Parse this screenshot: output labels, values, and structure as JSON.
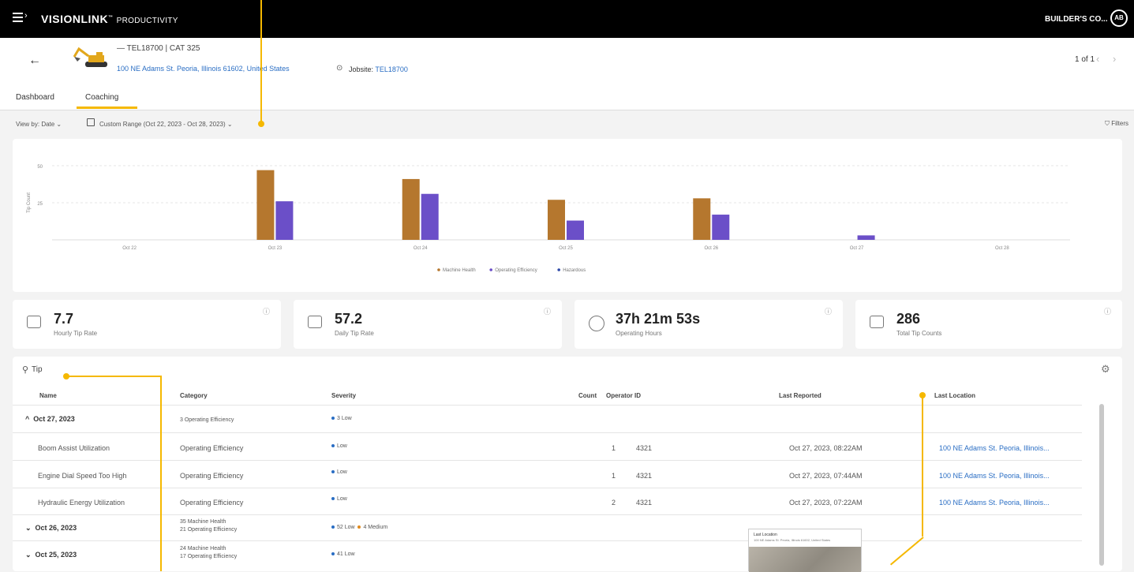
{
  "topbar": {
    "brand": "VISIONLINK",
    "brand_suffix": "PRODUCTIVITY",
    "company": "BUILDER'S CO...",
    "avatar": "AB"
  },
  "asset": {
    "name": "— TEL18700",
    "separator": "|",
    "model": "CAT 325",
    "address": "100 NE Adams St. Peoria, Illinois 61602, United States",
    "jobsite_label": "Jobsite:",
    "jobsite_value": "TEL18700"
  },
  "pager": {
    "text": "1 of 1",
    "prev": "‹",
    "next": "›"
  },
  "tabs": [
    {
      "label": "Dashboard"
    },
    {
      "label": "Coaching"
    }
  ],
  "toolbar": {
    "view_by": "View by: Date ⌄",
    "range": "Custom Range (Oct 22, 2023 - Oct 28, 2023) ⌄",
    "filters": "Filters"
  },
  "chart_data": {
    "type": "bar",
    "categories": [
      "Oct 22",
      "Oct 23",
      "Oct 24",
      "Oct 25",
      "Oct 26",
      "Oct 27",
      "Oct 28"
    ],
    "series": [
      {
        "name": "Machine Health",
        "values": [
          0,
          47,
          41,
          27,
          28,
          0,
          0
        ],
        "color": "#b5772e"
      },
      {
        "name": "Operating Efficiency",
        "values": [
          0,
          26,
          31,
          13,
          17,
          3,
          0
        ],
        "color": "#6b4fc8"
      },
      {
        "name": "Hazardous",
        "values": [
          0,
          0,
          0,
          0,
          0,
          0,
          0
        ],
        "color": "#2f4aa8"
      }
    ],
    "ylabel": "Tip Count",
    "yticks": [
      "50",
      "25"
    ],
    "ylim": [
      0,
      50
    ],
    "legend": "bottom"
  },
  "stats": [
    {
      "value": "7.7",
      "label": "Hourly Tip Rate"
    },
    {
      "value": "57.2",
      "label": "Daily Tip Rate"
    },
    {
      "value": "37h 21m 53s",
      "label": "Operating Hours"
    },
    {
      "value": "286",
      "label": "Total Tip Counts"
    }
  ],
  "table": {
    "search_value": "Tip",
    "columns": [
      "Name",
      "Category",
      "Severity",
      "Count",
      "Operator ID",
      "Last Reported",
      "Last Location"
    ],
    "groups": [
      {
        "date": "Oct 27, 2023",
        "category": "3 Operating Efficiency",
        "severity": "3 Low"
      },
      {
        "date": "Oct 26, 2023",
        "category_1": "35 Machine Health",
        "category_2": "21 Operating Efficiency",
        "severity_low": "52 Low",
        "severity_medium": "4 Medium"
      },
      {
        "date": "Oct 25, 2023",
        "category_1": "24 Machine Health",
        "category_2": "17 Operating Efficiency",
        "severity": "41 Low"
      }
    ],
    "rows": [
      {
        "name": "Boom Assist Utilization",
        "category": "Operating Efficiency",
        "severity": "Low",
        "count": "1",
        "operator": "4321",
        "reported": "Oct 27, 2023, 08:22AM",
        "location": "100 NE Adams St. Peoria, Illinois..."
      },
      {
        "name": "Engine Dial Speed Too High",
        "category": "Operating Efficiency",
        "severity": "Low",
        "count": "1",
        "operator": "4321",
        "reported": "Oct 27, 2023, 07:44AM",
        "location": "100 NE Adams St. Peoria, Illinois..."
      },
      {
        "name": "Hydraulic Energy Utilization",
        "category": "Operating Efficiency",
        "severity": "Low",
        "count": "2",
        "operator": "4321",
        "reported": "Oct 27, 2023, 07:22AM",
        "location": "100 NE Adams St. Peoria, Illinois..."
      }
    ],
    "map_popup": {
      "title": "Last Location",
      "subtitle": "100 NE Adams St. Peoria, Illinois 61602, United States"
    }
  },
  "colors": {
    "accent": "#f5b800",
    "link": "#2a6ec4",
    "low": "#2a6ec4",
    "medium": "#e08a1e"
  }
}
